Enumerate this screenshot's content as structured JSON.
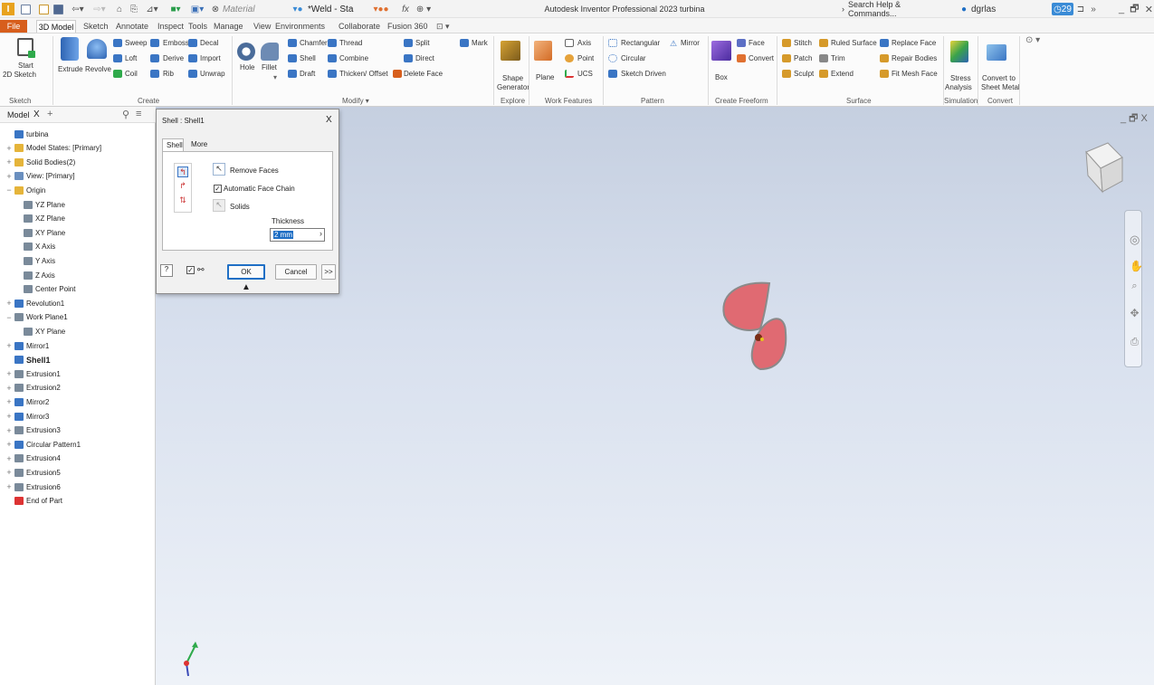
{
  "titlebar": {
    "doc_tab": "Material",
    "appearance": "*Weld - Sta",
    "fx": "fx",
    "app_title": "Autodesk Inventor Professional 2023   turbina",
    "search": "Search Help & Commands...",
    "user": "dgrlas",
    "clock": "29",
    "overflow": "»",
    "window_controls": "_ 🗗 X"
  },
  "tabs": [
    "File",
    "3D Model",
    "Sketch",
    "Annotate",
    "Inspect",
    "Tools",
    "Manage",
    "View",
    "Environments",
    "Collaborate",
    "Fusion 360"
  ],
  "ribbon": {
    "sketch": {
      "start": "Start",
      "sketch2d": "2D Sketch",
      "group": "Sketch"
    },
    "create": {
      "extrude": "Extrude",
      "revolve": "Revolve",
      "sweep": "Sweep",
      "emboss": "Emboss",
      "decal": "Decal",
      "loft": "Loft",
      "derive": "Derive",
      "import": "Import",
      "coil": "Coil",
      "rib": "Rib",
      "unwrap": "Unwrap",
      "group": "Create"
    },
    "modify": {
      "hole": "Hole",
      "fillet": "Fillet",
      "chamfer": "Chamfer",
      "thread": "Thread",
      "split": "Split",
      "mark": "Mark",
      "shell": "Shell",
      "combine": "Combine",
      "direct": "Direct",
      "draft": "Draft",
      "thicken": "Thicken/ Offset",
      "delete_face": "Delete Face",
      "group": "Modify ▾"
    },
    "explore": {
      "shape": "Shape",
      "generator": "Generator",
      "group": "Explore"
    },
    "work": {
      "plane": "Plane",
      "axis": "Axis",
      "point": "Point",
      "ucs": "UCS",
      "group": "Work Features"
    },
    "pattern": {
      "rectangular": "Rectangular",
      "mirror": "Mirror",
      "circular": "Circular",
      "sketch_driven": "Sketch Driven",
      "group": "Pattern"
    },
    "freeform": {
      "box": "Box",
      "face": "Face",
      "convert": "Convert",
      "group": "Create Freeform"
    },
    "surface": {
      "stitch": "Stitch",
      "ruled": "Ruled Surface",
      "replace": "Replace Face",
      "patch": "Patch",
      "trim": "Trim",
      "repair": "Repair Bodies",
      "sculpt": "Sculpt",
      "extend": "Extend",
      "fitmesh": "Fit Mesh Face",
      "group": "Surface"
    },
    "simulation": {
      "stress": "Stress",
      "analysis": "Analysis",
      "group": "Simulation"
    },
    "convert": {
      "convert_to": "Convert to",
      "sheet_metal": "Sheet Metal",
      "group": "Convert"
    }
  },
  "browser": {
    "tab": "Model",
    "close": "X",
    "add": "+",
    "nodes": [
      {
        "label": "turbina",
        "exp": ""
      },
      {
        "label": "Model States: [Primary]",
        "exp": "+"
      },
      {
        "label": "Solid Bodies(2)",
        "exp": "+"
      },
      {
        "label": "View: [Primary]",
        "exp": "+"
      },
      {
        "label": "Origin",
        "exp": "−"
      },
      {
        "label": "YZ Plane",
        "exp": ""
      },
      {
        "label": "XZ Plane",
        "exp": ""
      },
      {
        "label": "XY Plane",
        "exp": ""
      },
      {
        "label": "X Axis",
        "exp": ""
      },
      {
        "label": "Y Axis",
        "exp": ""
      },
      {
        "label": "Z Axis",
        "exp": ""
      },
      {
        "label": "Center Point",
        "exp": ""
      },
      {
        "label": "Revolution1",
        "exp": "+"
      },
      {
        "label": "Work Plane1",
        "exp": "−"
      },
      {
        "label": "XY Plane",
        "exp": ""
      },
      {
        "label": "Mirror1",
        "exp": "+"
      },
      {
        "label": "Shell1",
        "exp": ""
      },
      {
        "label": "Extrusion1",
        "exp": "+"
      },
      {
        "label": "Extrusion2",
        "exp": "+"
      },
      {
        "label": "Mirror2",
        "exp": "+"
      },
      {
        "label": "Mirror3",
        "exp": "+"
      },
      {
        "label": "Extrusion3",
        "exp": "+"
      },
      {
        "label": "Circular Pattern1",
        "exp": "+"
      },
      {
        "label": "Extrusion4",
        "exp": "+"
      },
      {
        "label": "Extrusion5",
        "exp": "+"
      },
      {
        "label": "Extrusion6",
        "exp": "+"
      },
      {
        "label": "End of Part",
        "exp": ""
      }
    ]
  },
  "dialog": {
    "title": "Shell : Shell1",
    "close": "X",
    "tab_shell": "Shell",
    "tab_more": "More",
    "remove_faces": "Remove Faces",
    "auto_chain": "Automatic Face Chain",
    "solids": "Solids",
    "thickness_label": "Thickness",
    "thickness_value": "2 mm",
    "ok": "OK",
    "cancel": "Cancel",
    "expand": ">>",
    "help": "?"
  },
  "viewport": {
    "window_controls": "_ 🗗 X"
  },
  "colors": {
    "accent": "#1f6fc5",
    "file_tab": "#d75e1c",
    "part": "#e06a72"
  }
}
